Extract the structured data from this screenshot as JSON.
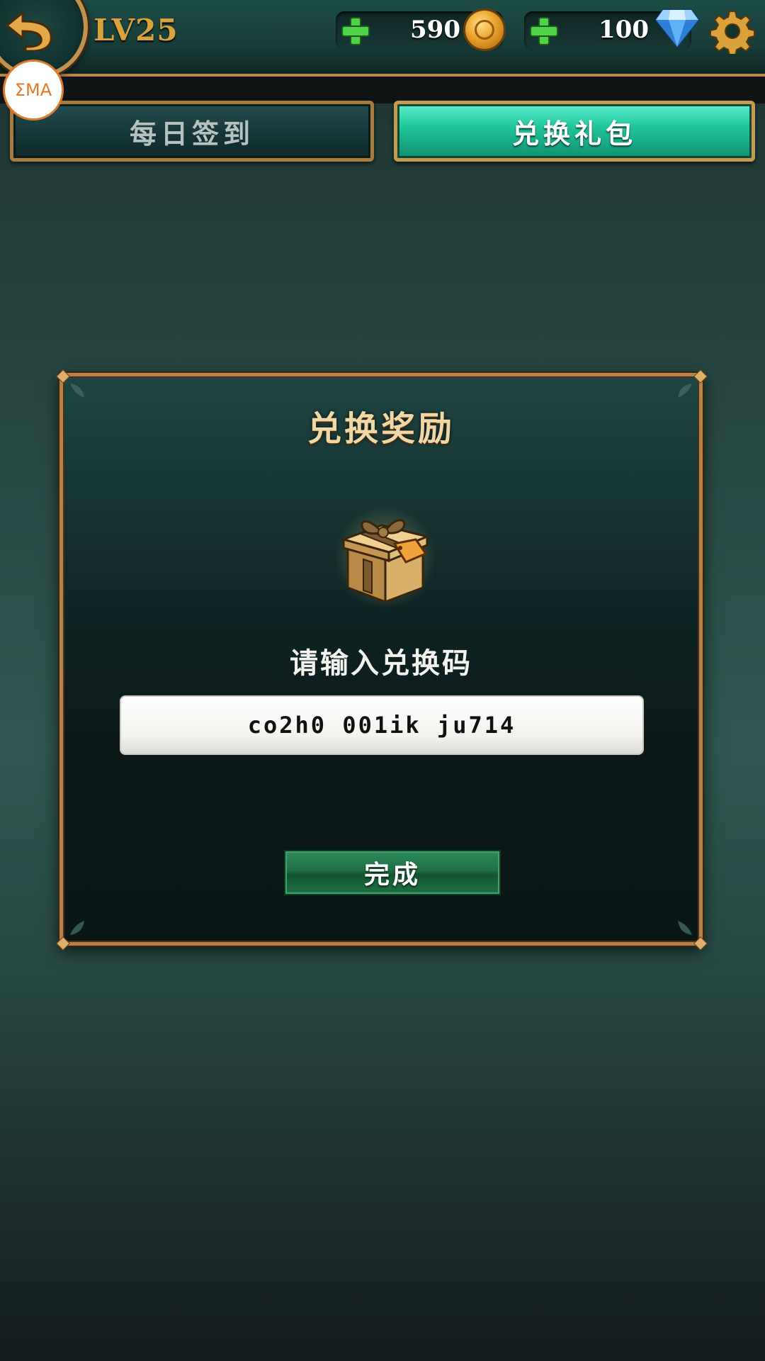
{
  "topbar": {
    "level": "LV25",
    "gold": "590",
    "diamonds": "100",
    "overlay_badge": "ΣMA"
  },
  "tabs": [
    {
      "label": "每日签到",
      "active": false
    },
    {
      "label": "兑换礼包",
      "active": true
    }
  ],
  "dialog": {
    "title": "兑换奖励",
    "prompt": "请输入兑换码",
    "code_value": "co2h0 001ik ju714",
    "done_label": "完成"
  },
  "icons": {
    "back": "back-arrow-icon",
    "gold": "gold-coin-icon",
    "diamond": "diamond-icon",
    "settings": "gear-icon",
    "gift": "gift-box-icon",
    "add": "plus-icon"
  },
  "colors": {
    "level_gold": "#d9a23d",
    "active_tab": "#22c79e",
    "frame_bronze": "#b5834a",
    "title_text": "#f0d7a6",
    "done_button": "#1f6e45",
    "plus_green": "#4fd24a"
  }
}
